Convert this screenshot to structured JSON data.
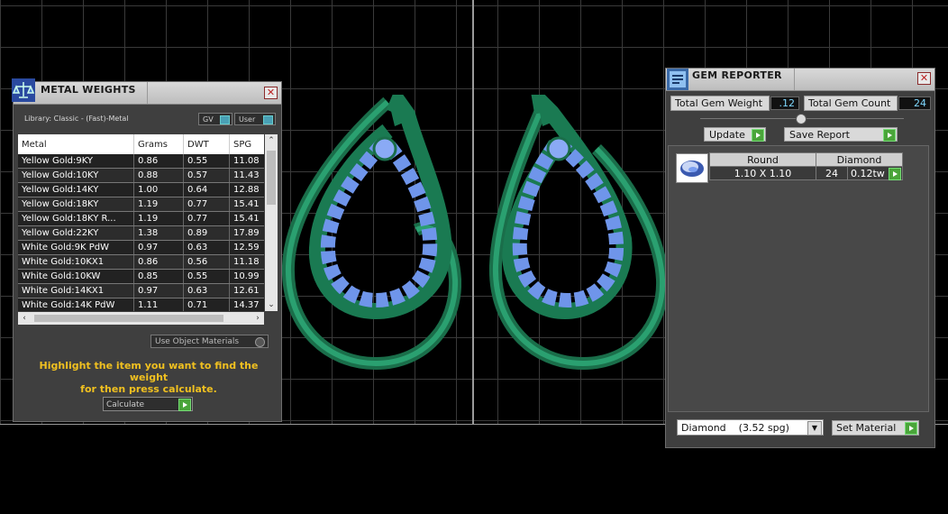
{
  "metal_weights": {
    "title": "METAL WEIGHTS",
    "library": "Library: Classic - (Fast)-Metal",
    "gv_label": "GV",
    "user_label": "User",
    "columns": [
      "Metal",
      "Grams",
      "DWT",
      "SPG"
    ],
    "rows": [
      [
        "Yellow Gold:9KY",
        "0.86",
        "0.55",
        "11.08"
      ],
      [
        "Yellow Gold:10KY",
        "0.88",
        "0.57",
        "11.43"
      ],
      [
        "Yellow Gold:14KY",
        "1.00",
        "0.64",
        "12.88"
      ],
      [
        "Yellow Gold:18KY",
        "1.19",
        "0.77",
        "15.41"
      ],
      [
        "Yellow Gold:18KY R...",
        "1.19",
        "0.77",
        "15.41"
      ],
      [
        "Yellow Gold:22KY",
        "1.38",
        "0.89",
        "17.89"
      ],
      [
        "White Gold:9K PdW",
        "0.97",
        "0.63",
        "12.59"
      ],
      [
        "White Gold:10KX1",
        "0.86",
        "0.56",
        "11.18"
      ],
      [
        "White Gold:10KW",
        "0.85",
        "0.55",
        "10.99"
      ],
      [
        "White Gold:14KX1",
        "0.97",
        "0.63",
        "12.61"
      ],
      [
        "White Gold:14K PdW",
        "1.11",
        "0.71",
        "14.37"
      ]
    ],
    "use_object_materials": "Use Object Materials",
    "hint_line1": "Highlight the item you want to find the weight",
    "hint_line2": "for then press calculate.",
    "calculate_label": "Calculate"
  },
  "gem_reporter": {
    "title": "GEM REPORTER",
    "total_gem_weight_label": "Total Gem Weight",
    "total_gem_weight_value": ".12",
    "total_gem_count_label": "Total Gem Count",
    "total_gem_count_value": "24",
    "update_label": "Update",
    "save_report_label": "Save Report",
    "gem": {
      "shape": "Round",
      "material": "Diamond",
      "size": "1.10 X 1.10",
      "count": "24",
      "weight": "0.12tw"
    },
    "material_select": "Diamond    (3.52 spg)",
    "set_material_label": "Set Material"
  },
  "colors": {
    "metal_green": "#1f8a5c",
    "gem_blue": "#7a9ef0",
    "hint_yellow": "#f0c020",
    "value_cyan": "#7fd8ff"
  }
}
